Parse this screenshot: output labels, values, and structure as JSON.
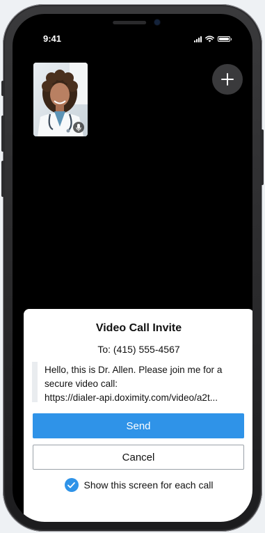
{
  "status_bar": {
    "time": "9:41"
  },
  "call": {
    "self_view_icons": [
      "doctor-photo",
      "microphone-icon"
    ],
    "add_icon": "plus-icon"
  },
  "invite": {
    "title": "Video Call Invite",
    "recipient": "To: (415) 555-4567",
    "message": "Hello, this is Dr. Allen. Please join me for a\nsecure video call:\nhttps://dialer-api.doximity.com/video/a2t...",
    "send_label": "Send",
    "cancel_label": "Cancel",
    "show_screen_label": "Show this screen for each call",
    "show_screen_checked": true
  },
  "colors": {
    "accent": "#2f93e8",
    "background": "#000000",
    "sheet": "#ffffff"
  }
}
